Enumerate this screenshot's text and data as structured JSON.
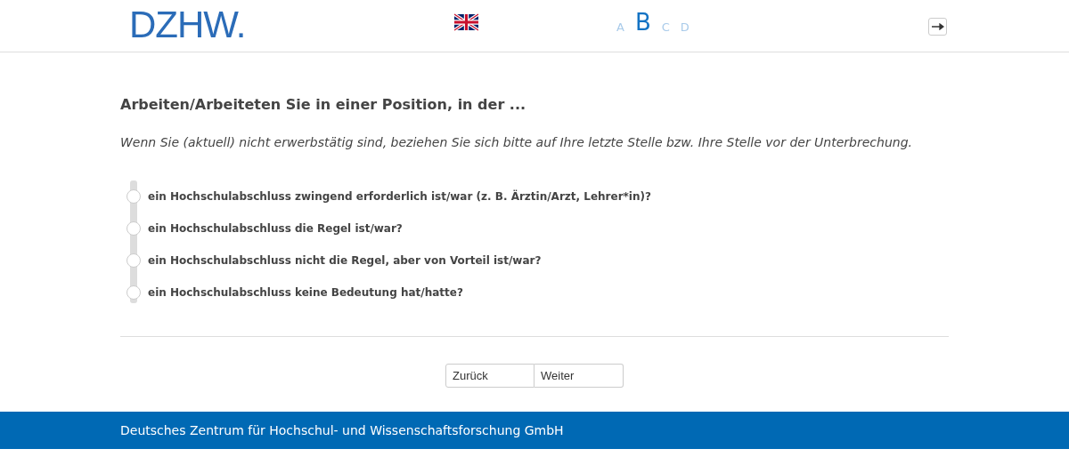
{
  "header": {
    "logo": "DZHW.",
    "languages": [
      {
        "label": "A",
        "selected": false
      },
      {
        "label": "B",
        "selected": true
      },
      {
        "label": "C",
        "selected": false
      },
      {
        "label": "D",
        "selected": false
      }
    ]
  },
  "question": {
    "title": "Arbeiten/Arbeiteten Sie in einer Position, in der ...",
    "instruction": "Wenn Sie (aktuell) nicht erwerbstätig sind, beziehen Sie sich bitte auf Ihre letzte Stelle bzw. Ihre Stelle vor der Unterbrechung.",
    "options": [
      {
        "label": "ein Hochschulabschluss zwingend erforderlich ist/war (z. B. Ärztin/Arzt, Lehrer*in)?",
        "selected": false
      },
      {
        "label": "ein Hochschulabschluss die Regel ist/war?",
        "selected": false
      },
      {
        "label": "ein Hochschulabschluss nicht die Regel, aber von Vorteil ist/war?",
        "selected": false
      },
      {
        "label": "ein Hochschulabschluss keine Bedeutung hat/hatte?",
        "selected": false
      }
    ]
  },
  "navigation": {
    "back": "Zurück",
    "next": "Weiter"
  },
  "footer": "Deutsches Zentrum für Hochschul- und Wissenschaftsforschung GmbH"
}
